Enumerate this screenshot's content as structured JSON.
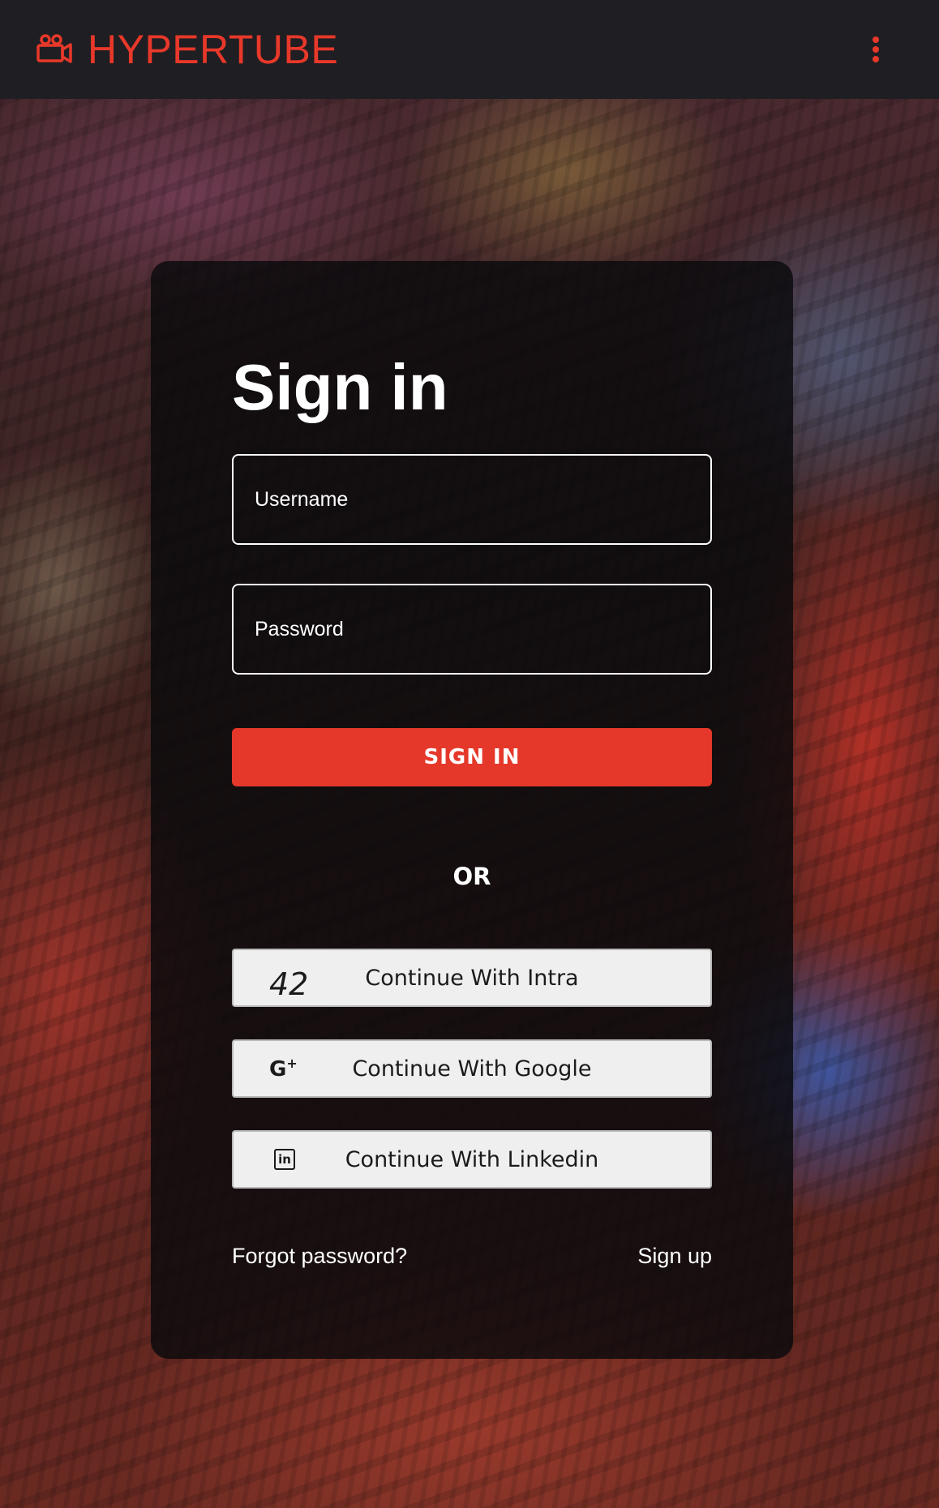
{
  "header": {
    "brand_name": "HYPERTUBE",
    "brand_icon": "video-camera-icon",
    "menu_icon": "more-vertical-icon",
    "accent_color": "#e8382a"
  },
  "signin": {
    "title": "Sign in",
    "username_placeholder": "Username",
    "password_placeholder": "Password",
    "submit_label": "SIGN IN",
    "divider_label": "OR",
    "intra_icon_text": "42",
    "intra_label": "Continue With Intra",
    "google_icon_text": "G",
    "google_icon_sup": "+",
    "google_label": "Continue With Google",
    "linkedin_icon_text": "in",
    "linkedin_label": "Continue With Linkedin",
    "forgot_label": "Forgot password?",
    "signup_label": "Sign up"
  }
}
